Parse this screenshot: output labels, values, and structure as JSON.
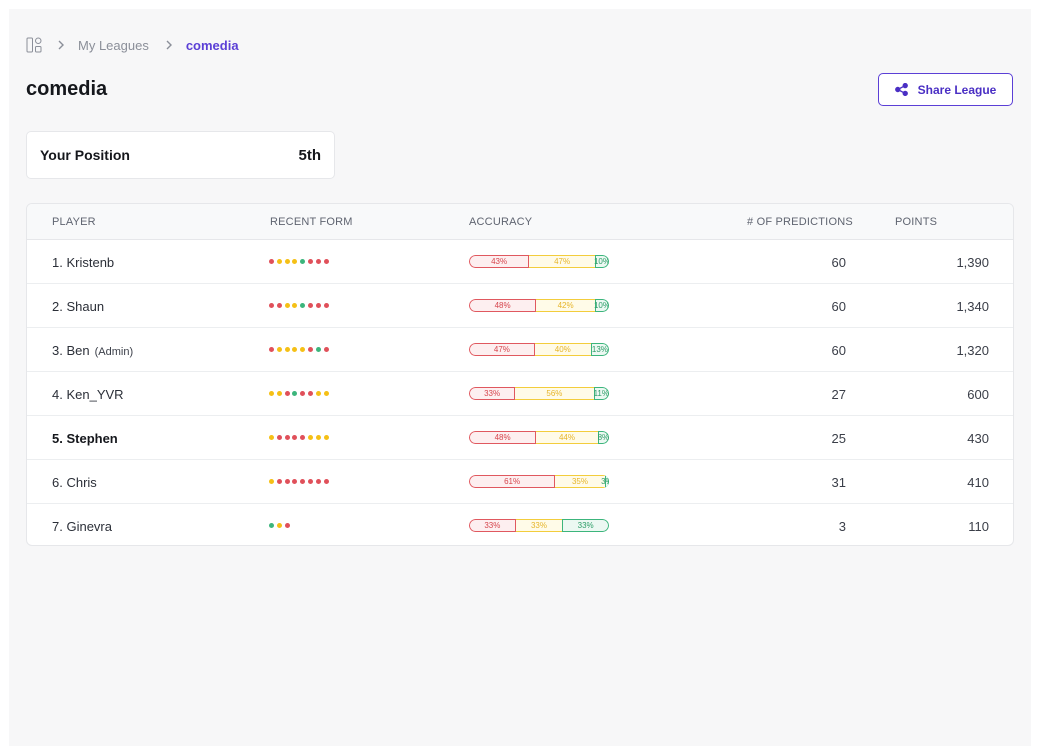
{
  "breadcrumb": {
    "home_icon": "grid-icon",
    "items": [
      "My Leagues",
      "comedia"
    ]
  },
  "title": "comedia",
  "share_button": {
    "label": "Share League",
    "icon": "share-icon"
  },
  "position": {
    "label": "Your Position",
    "value": "5th"
  },
  "table": {
    "headers": {
      "player": "PLAYER",
      "form": "RECENT FORM",
      "accuracy": "ACCURACY",
      "predictions": "# OF PREDICTIONS",
      "points": "POINTS"
    },
    "rows": [
      {
        "rank": "1.",
        "name": "Kristenb",
        "admin": "",
        "bold": false,
        "form": [
          "red",
          "yellow",
          "yellow",
          "yellow",
          "green",
          "red",
          "red",
          "red"
        ],
        "accuracy": {
          "red": 43,
          "yellow": 47,
          "green": 10
        },
        "predictions": "60",
        "points": "1,390"
      },
      {
        "rank": "2.",
        "name": "Shaun",
        "admin": "",
        "bold": false,
        "form": [
          "red",
          "red",
          "yellow",
          "yellow",
          "green",
          "red",
          "red",
          "red"
        ],
        "accuracy": {
          "red": 48,
          "yellow": 42,
          "green": 10
        },
        "predictions": "60",
        "points": "1,340"
      },
      {
        "rank": "3.",
        "name": "Ben",
        "admin": "(Admin)",
        "bold": false,
        "form": [
          "red",
          "yellow",
          "yellow",
          "yellow",
          "yellow",
          "red",
          "green",
          "red"
        ],
        "accuracy": {
          "red": 47,
          "yellow": 40,
          "green": 13
        },
        "predictions": "60",
        "points": "1,320"
      },
      {
        "rank": "4.",
        "name": "Ken_YVR",
        "admin": "",
        "bold": false,
        "form": [
          "yellow",
          "yellow",
          "red",
          "green",
          "red",
          "red",
          "yellow",
          "yellow"
        ],
        "accuracy": {
          "red": 33,
          "yellow": 56,
          "green": 11
        },
        "predictions": "27",
        "points": "600"
      },
      {
        "rank": "5.",
        "name": "Stephen",
        "admin": "",
        "bold": true,
        "form": [
          "yellow",
          "red",
          "red",
          "red",
          "red",
          "yellow",
          "yellow",
          "yellow"
        ],
        "accuracy": {
          "red": 48,
          "yellow": 44,
          "green": 8
        },
        "predictions": "25",
        "points": "430"
      },
      {
        "rank": "6.",
        "name": "Chris",
        "admin": "",
        "bold": false,
        "form": [
          "yellow",
          "red",
          "red",
          "red",
          "red",
          "red",
          "red",
          "red"
        ],
        "accuracy": {
          "red": 61,
          "yellow": 35,
          "green": 3
        },
        "predictions": "31",
        "points": "410"
      },
      {
        "rank": "7.",
        "name": "Ginevra",
        "admin": "",
        "bold": false,
        "form": [
          "green",
          "yellow",
          "red"
        ],
        "accuracy": {
          "red": 33,
          "yellow": 33,
          "green": 33
        },
        "predictions": "3",
        "points": "110"
      }
    ]
  },
  "colors": {
    "accent": "#5b3fd6",
    "red": "#e0505a",
    "yellow": "#f5c016",
    "green": "#3cb57c"
  }
}
